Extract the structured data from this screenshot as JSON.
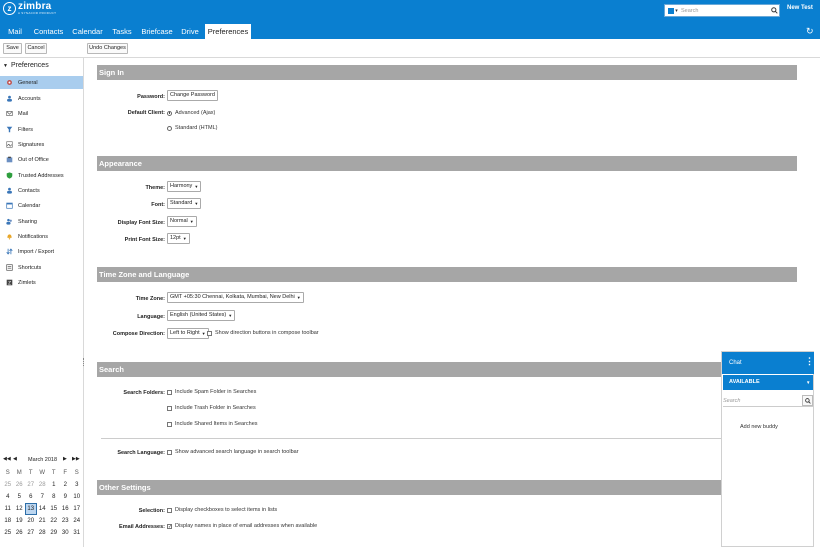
{
  "header": {
    "logo_name": "zimbra",
    "logo_sub": "A SYNACOR PRODUCT",
    "search_placeholder": "Search",
    "user_name": "New Test"
  },
  "tabs": [
    {
      "label": "Mail"
    },
    {
      "label": "Contacts"
    },
    {
      "label": "Calendar"
    },
    {
      "label": "Tasks"
    },
    {
      "label": "Briefcase"
    },
    {
      "label": "Drive"
    },
    {
      "label": "Preferences",
      "active": true
    }
  ],
  "toolbar": {
    "save_label": "Save",
    "cancel_label": "Cancel",
    "undo_label": "Undo Changes"
  },
  "sidebar": {
    "header": "Preferences",
    "items": [
      {
        "label": "General",
        "icon": "gear-icon",
        "selected": true
      },
      {
        "label": "Accounts",
        "icon": "accounts-icon"
      },
      {
        "label": "Mail",
        "icon": "mail-icon"
      },
      {
        "label": "Filters",
        "icon": "filter-icon"
      },
      {
        "label": "Signatures",
        "icon": "signature-icon"
      },
      {
        "label": "Out of Office",
        "icon": "out-of-office-icon"
      },
      {
        "label": "Trusted Addresses",
        "icon": "shield-icon"
      },
      {
        "label": "Contacts",
        "icon": "contacts-icon"
      },
      {
        "label": "Calendar",
        "icon": "calendar-icon"
      },
      {
        "label": "Sharing",
        "icon": "sharing-icon"
      },
      {
        "label": "Notifications",
        "icon": "bell-icon"
      },
      {
        "label": "Import / Export",
        "icon": "import-export-icon"
      },
      {
        "label": "Shortcuts",
        "icon": "keyboard-icon"
      },
      {
        "label": "Zimlets",
        "icon": "zimlet-icon"
      }
    ]
  },
  "calendar": {
    "month": "March 2018",
    "dow": [
      "S",
      "M",
      "T",
      "W",
      "T",
      "F",
      "S"
    ],
    "weeks": [
      [
        "25",
        "26",
        "27",
        "28",
        "1",
        "2",
        "3"
      ],
      [
        "4",
        "5",
        "6",
        "7",
        "8",
        "9",
        "10"
      ],
      [
        "11",
        "12",
        "13",
        "14",
        "15",
        "16",
        "17"
      ],
      [
        "18",
        "19",
        "20",
        "21",
        "22",
        "23",
        "24"
      ],
      [
        "25",
        "26",
        "27",
        "28",
        "29",
        "30",
        "31"
      ]
    ],
    "today": "13"
  },
  "sections": {
    "signin": {
      "title": "Sign In",
      "password_label": "Password:",
      "change_password": "Change Password",
      "default_client_label": "Default Client:",
      "client_advanced": "Advanced (Ajax)",
      "client_standard": "Standard (HTML)"
    },
    "appearance": {
      "title": "Appearance",
      "theme_label": "Theme:",
      "theme_value": "Harmony",
      "font_label": "Font:",
      "font_value": "Standard",
      "display_font_size_label": "Display Font Size:",
      "display_font_size_value": "Normal",
      "print_font_size_label": "Print Font Size:",
      "print_font_size_value": "12pt"
    },
    "timezone": {
      "title": "Time Zone and Language",
      "tz_label": "Time Zone:",
      "tz_value": "GMT +05:30 Chennai, Kolkata, Mumbai, New Delhi",
      "language_label": "Language:",
      "language_value": "English (United States)",
      "compose_dir_label": "Compose Direction:",
      "compose_dir_value": "Left to Right",
      "show_dir_buttons": "Show direction buttons in compose toolbar"
    },
    "search": {
      "title": "Search",
      "folders_label": "Search Folders:",
      "spam": "Include Spam Folder in Searches",
      "trash": "Include Trash Folder in Searches",
      "shared": "Include Shared Items in Searches",
      "language_label": "Search Language:",
      "advanced_language": "Show advanced search language in search toolbar"
    },
    "other": {
      "title": "Other Settings",
      "selection_label": "Selection:",
      "selection_option": "Display checkboxes to select items in lists",
      "email_label": "Email Addresses:",
      "email_option": "Display names in place of email addresses when available"
    }
  },
  "chat": {
    "title": "Chat",
    "status": "AVAILABLE",
    "search_placeholder": "Search",
    "add_buddy": "Add new buddy"
  },
  "colors": {
    "brand": "#0a7fd0",
    "section_bar": "#a6a6a6",
    "selected_nav": "#a9cdee"
  }
}
